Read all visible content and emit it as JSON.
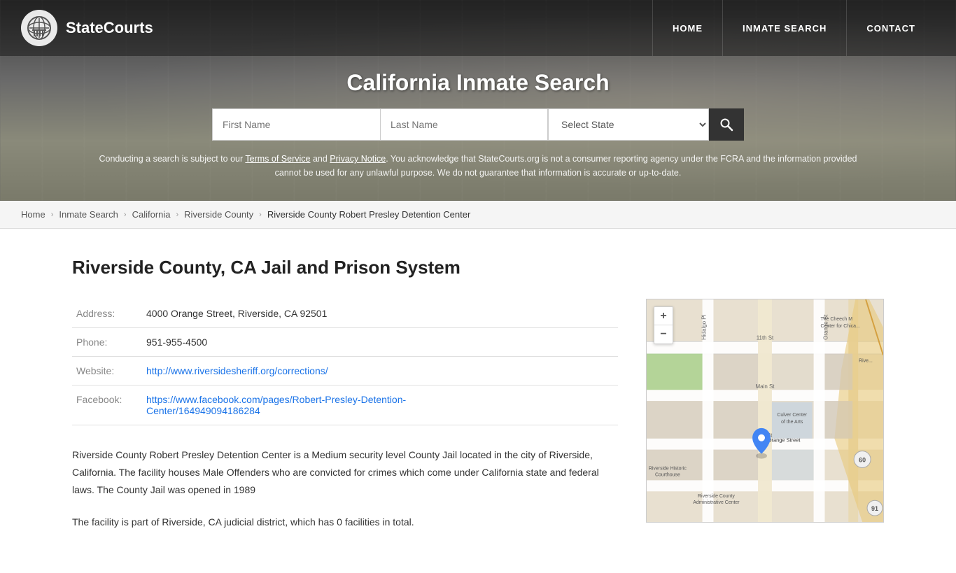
{
  "site": {
    "name": "StateCourts"
  },
  "nav": {
    "home": "HOME",
    "inmate_search": "INMATE SEARCH",
    "contact": "CONTACT"
  },
  "hero": {
    "title": "California Inmate Search",
    "search": {
      "first_name_placeholder": "First Name",
      "last_name_placeholder": "Last Name",
      "select_state_default": "Select State",
      "search_icon": "🔍"
    },
    "disclaimer": "Conducting a search is subject to our Terms of Service and Privacy Notice. You acknowledge that StateCourts.org is not a consumer reporting agency under the FCRA and the information provided cannot be used for any unlawful purpose. We do not guarantee that information is accurate or up-to-date."
  },
  "breadcrumb": {
    "items": [
      {
        "label": "Home",
        "link": true
      },
      {
        "label": "Inmate Search",
        "link": true
      },
      {
        "label": "California",
        "link": true
      },
      {
        "label": "Riverside County",
        "link": true
      },
      {
        "label": "Riverside County Robert Presley Detention Center",
        "link": false
      }
    ]
  },
  "facility": {
    "page_title": "Riverside County, CA Jail and Prison System",
    "address_label": "Address:",
    "address_value": "4000 Orange Street, Riverside, CA 92501",
    "phone_label": "Phone:",
    "phone_value": "951-955-4500",
    "website_label": "Website:",
    "website_url": "http://www.riversidesheriff.org/corrections/",
    "website_text": "http://www.riversidesheriff.org/corrections/",
    "facebook_label": "Facebook:",
    "facebook_url": "https://www.facebook.com/pages/Robert-Presley-Detention-Center/164949094186284",
    "facebook_text": "https://www.facebook.com/pages/Robert-Presley-Detention-\nCenter/164949094186284",
    "description1": "Riverside County Robert Presley Detention Center is a Medium security level County Jail located in the city of Riverside, California. The facility houses Male Offenders who are convicted for crimes which come under California state and federal laws. The County Jail was opened in 1989",
    "description2": "The facility is part of Riverside, CA judicial district, which has 0 facilities in total."
  }
}
